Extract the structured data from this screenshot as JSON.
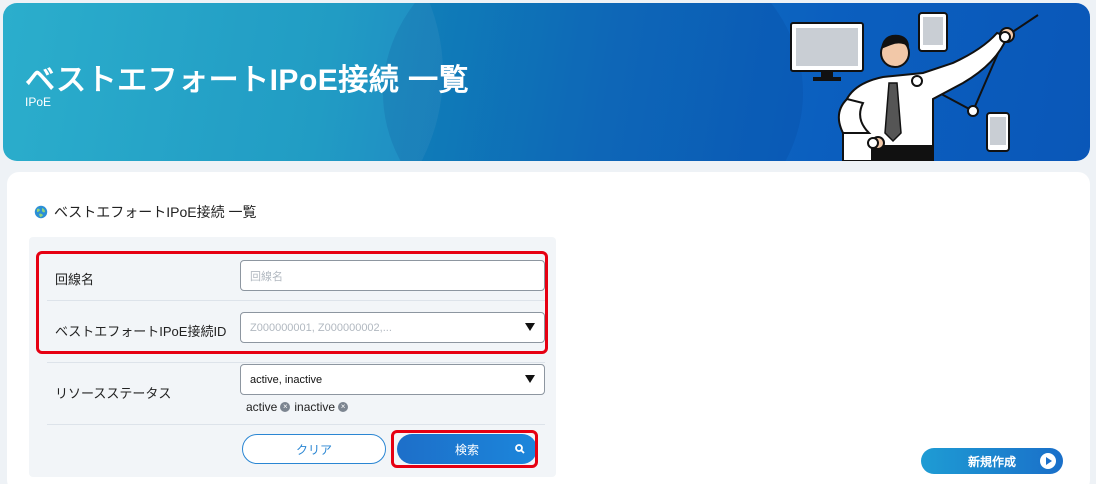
{
  "banner": {
    "title": "ベストエフォートIPoE接続 一覧",
    "subtitle": "IPoE"
  },
  "section": {
    "title": "ベストエフォートIPoE接続 一覧",
    "icon": "globe-icon"
  },
  "form": {
    "line_name": {
      "label": "回線名",
      "placeholder": "回線名",
      "value": ""
    },
    "connection_id": {
      "label": "ベストエフォートIPoE接続ID",
      "placeholder": "Z000000001, Z000000002,...",
      "value": ""
    },
    "resource_status": {
      "label": "リソースステータス",
      "value": "active, inactive",
      "tags": [
        "active",
        "inactive"
      ]
    },
    "clear_label": "クリア",
    "search_label": "検索"
  },
  "actions": {
    "new_label": "新規作成"
  },
  "colors": {
    "accent": "#1c7ed6",
    "highlight": "#e60012"
  }
}
